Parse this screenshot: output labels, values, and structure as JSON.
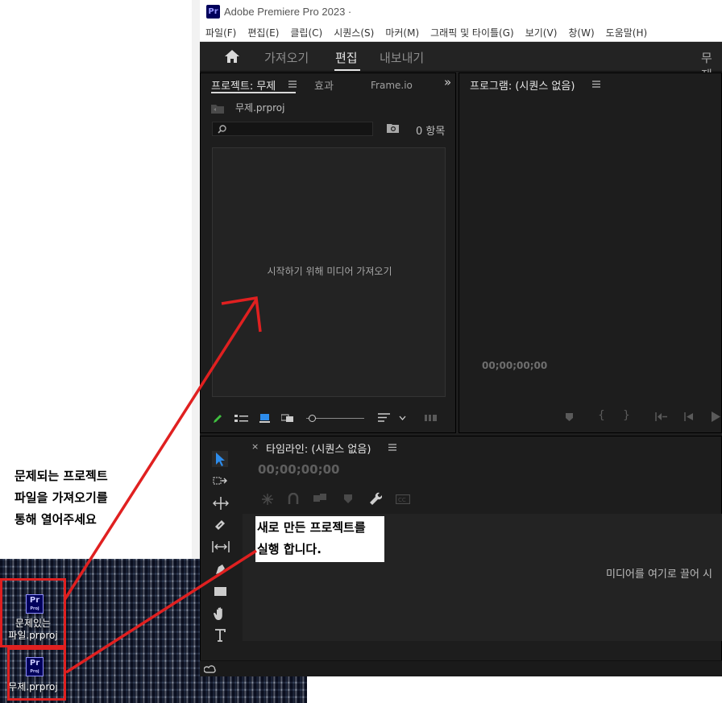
{
  "window": {
    "title": "Adobe Premiere Pro 2023 ·",
    "app_icon": "Pr"
  },
  "menu": [
    "파일(F)",
    "편집(E)",
    "클립(C)",
    "시퀀스(S)",
    "마커(M)",
    "그래픽 및 타이틀(G)",
    "보기(V)",
    "창(W)",
    "도움말(H)"
  ],
  "workspace": {
    "tabs": [
      "가져오기",
      "편집",
      "내보내기"
    ],
    "active": "편집",
    "right_label": "무제"
  },
  "project_panel": {
    "tabs": [
      "프로젝트: 무제",
      "효과",
      "Frame.io"
    ],
    "overflow": "»",
    "file_name": "무제.prproj",
    "item_count": "0 항목",
    "empty_message": "시작하기 위해 미디어 가져오기"
  },
  "program_panel": {
    "title": "프로그램: (시퀀스 없음)",
    "timecode": "00;00;00;00"
  },
  "timeline_panel": {
    "close": "×",
    "title": "타임라인: (시퀀스 없음)",
    "timecode": "00;00;00;00",
    "drop_hint": "미디어를 여기로 끌어 시"
  },
  "annotations": {
    "note_left": [
      "문제되는 프로젝트",
      "파일을 가져오기를",
      "통해 열어주세요"
    ],
    "note_mid": [
      "새로 만든 프로젝트를",
      "실행 합니다."
    ],
    "arrow_color": "#e02020"
  },
  "desktop_icons": [
    {
      "label_line1": "문제있는",
      "label_line2": "파일.prproj",
      "glyph": "Pr"
    },
    {
      "label_line1": "무제.prproj",
      "label_line2": "",
      "glyph": "Pr"
    }
  ],
  "colors": {
    "panel_bg": "#1d1d1d",
    "accent_blue": "#2d8ceb",
    "pr_purple": "#00005b"
  }
}
